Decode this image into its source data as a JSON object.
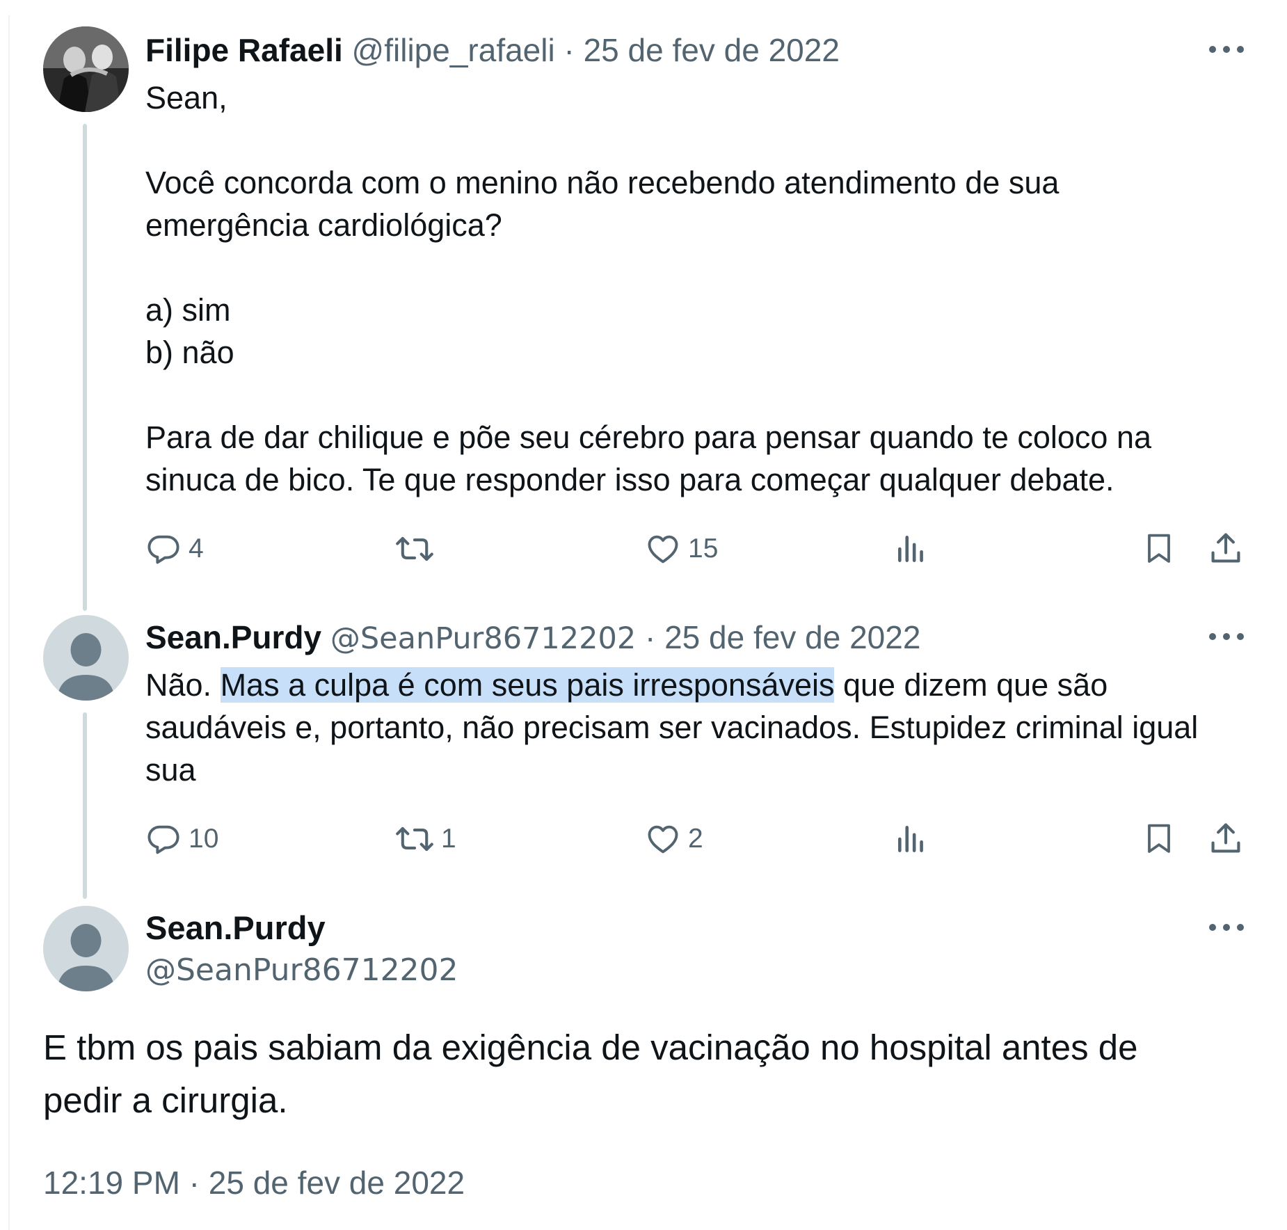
{
  "colors": {
    "text": "#0f1419",
    "secondary": "#536471",
    "thread_line": "#cfd9de",
    "highlight": "#c7dff8"
  },
  "tweet1": {
    "display_name": "Filipe Rafaeli",
    "handle": "@filipe_rafaeli",
    "separator": "·",
    "date": "25 de fev de 2022",
    "lines": {
      "l1": "Sean,",
      "l2": "Você concorda com o menino não recebendo atendimento de sua",
      "l3": "emergência cardiológica?",
      "l4": "a) sim",
      "l5": "b) não",
      "l6": "Para de dar chilique e põe seu cérebro para pensar quando te coloco na",
      "l7": "sinuca de bico. Te que responder isso para começar qualquer debate."
    },
    "actions": {
      "reply_count": "4",
      "retweet_count": "",
      "like_count": "15"
    }
  },
  "tweet2": {
    "display_name": "Sean.Purdy",
    "handle": "@SeanPur86712202",
    "separator": "·",
    "date": "25 de fev de 2022",
    "line1_pre": "Não. ",
    "line1_highlight": "Mas a culpa é com seus pais irresponsáveis",
    "line1_post": " que dizem que são",
    "line2": "saudáveis e, portanto, não precisam ser vacinados. Estupidez criminal igual",
    "line3": "sua",
    "actions": {
      "reply_count": "10",
      "retweet_count": "1",
      "like_count": "2"
    }
  },
  "main_tweet": {
    "display_name": "Sean.Purdy",
    "handle": "@SeanPur86712202",
    "line1": "E tbm os pais sabiam da exigência de vacinação no hospital antes de",
    "line2": "pedir a cirurgia.",
    "timestamp": "12:19 PM · 25 de fev de 2022"
  },
  "icons": [
    "reply-icon",
    "retweet-icon",
    "like-icon",
    "views-icon",
    "bookmark-icon",
    "share-icon",
    "more-icon"
  ]
}
